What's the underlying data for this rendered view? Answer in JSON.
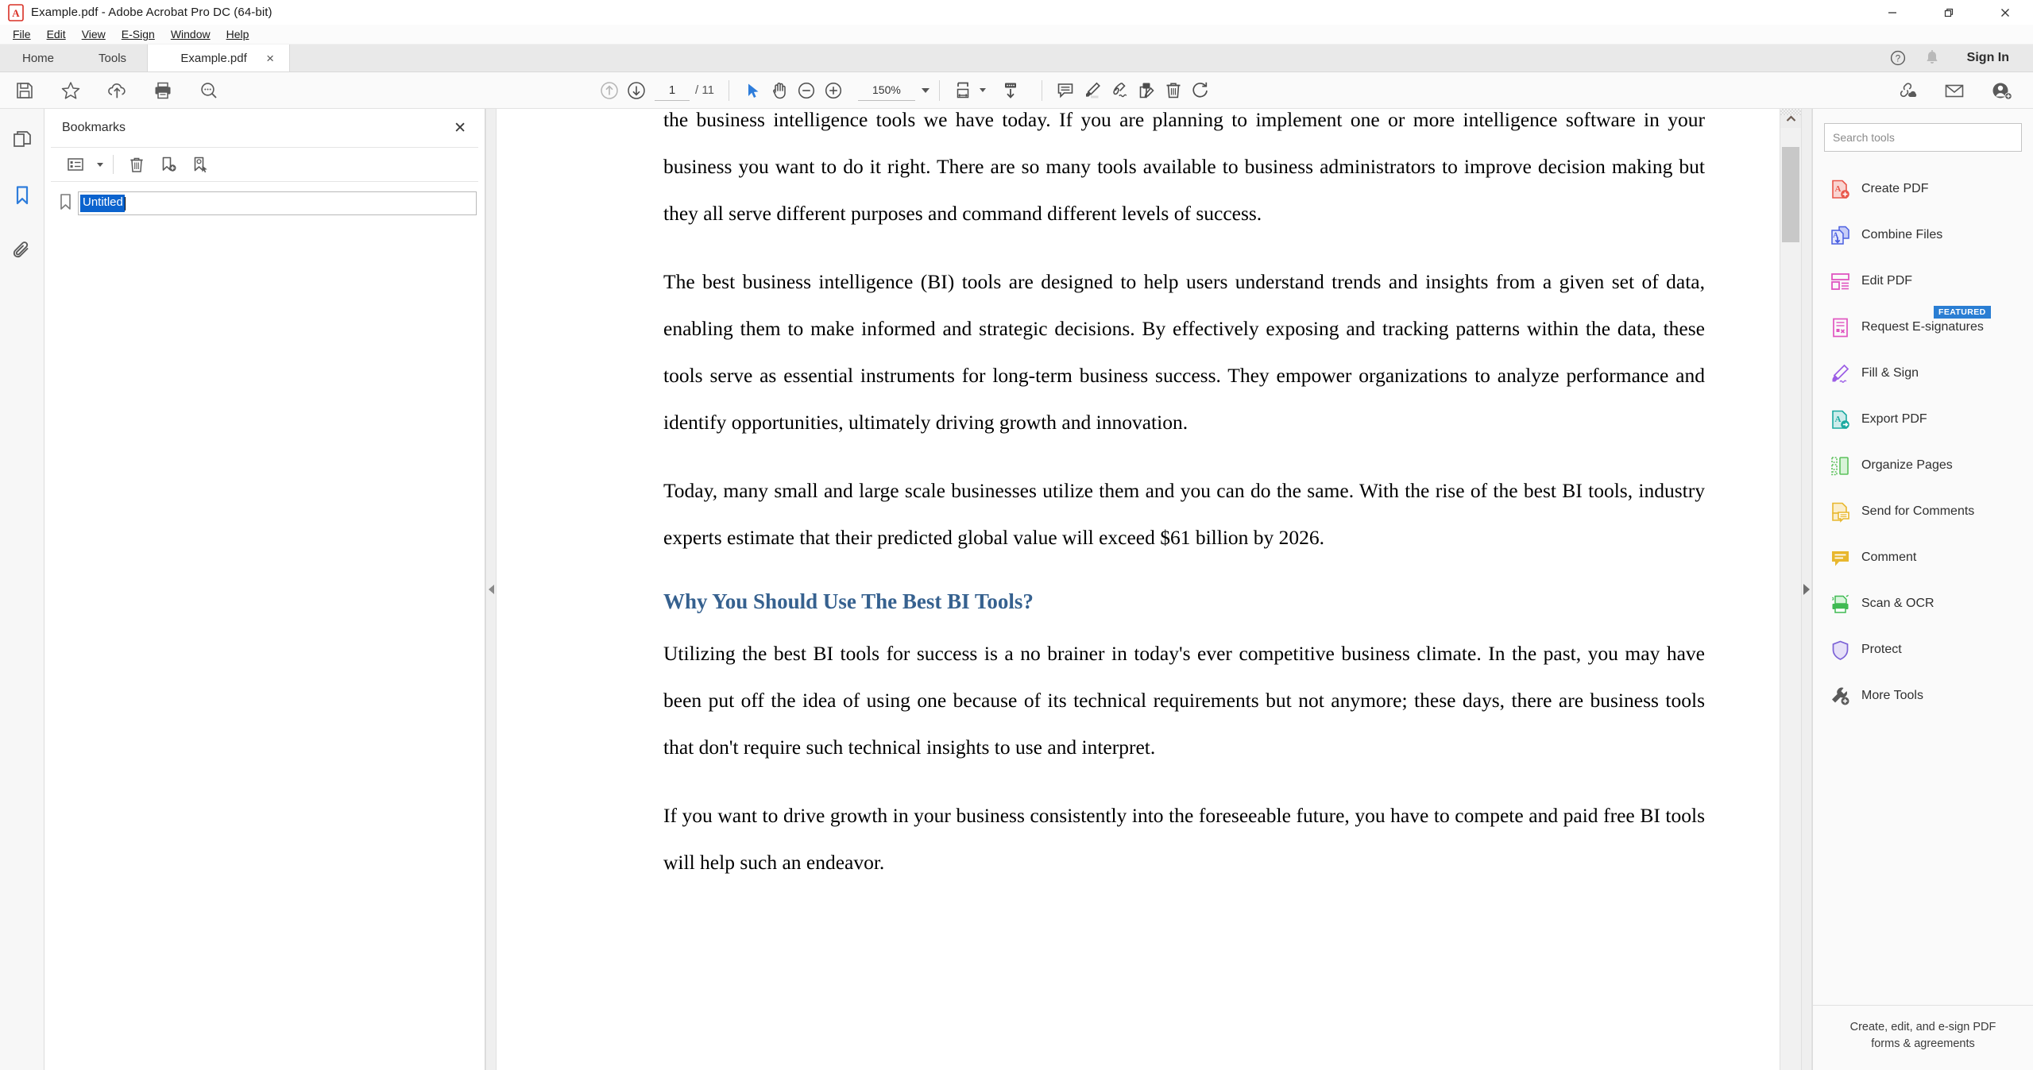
{
  "window": {
    "title": "Example.pdf - Adobe Acrobat Pro DC (64-bit)",
    "minimize": "—",
    "restore": "❐",
    "close": "✕"
  },
  "menubar": {
    "items": [
      {
        "label": "File",
        "key": "F"
      },
      {
        "label": "Edit",
        "key": "E"
      },
      {
        "label": "View",
        "key": "V"
      },
      {
        "label": "E-Sign",
        "key": "S"
      },
      {
        "label": "Window",
        "key": "W"
      },
      {
        "label": "Help",
        "key": "H"
      }
    ]
  },
  "tabbar": {
    "home": "Home",
    "tools": "Tools",
    "document_tab": "Example.pdf",
    "close_tab": "×",
    "help_icon": "help-circle-icon",
    "bell_icon": "bell-icon",
    "signin": "Sign In"
  },
  "toolbar": {
    "left_icons": [
      "save-icon",
      "star-icon",
      "upload-cloud-icon",
      "print-icon",
      "search-zoom-icon"
    ],
    "prev_page_icon": "arrow-up-circle-icon",
    "next_page_icon": "arrow-down-circle-icon",
    "page_current": "1",
    "page_total": "/ 11",
    "select_icon": "cursor-arrow-icon",
    "hand_icon": "hand-icon",
    "zoom_out_icon": "zoom-out-icon",
    "zoom_in_icon": "zoom-in-icon",
    "zoom_level": "150%",
    "fit_page_icon": "fit-page-icon",
    "scroll_mode_icon": "scroll-down-icon",
    "comment_icon": "comment-icon",
    "highlight_icon": "highlighter-icon",
    "sign_icon": "sign-pen-icon",
    "edit_page_icon": "edit-page-icon",
    "delete_icon": "trash-icon",
    "rotate_icon": "rotate-icon",
    "share_link_icon": "share-link-cloud-icon",
    "email_icon": "email-icon",
    "add_person_icon": "add-person-icon"
  },
  "rail": {
    "items": [
      {
        "name": "page-thumbnails-icon",
        "active": false
      },
      {
        "name": "bookmarks-icon",
        "active": true
      },
      {
        "name": "attachments-icon",
        "active": false
      }
    ]
  },
  "bookmarks": {
    "title": "Bookmarks",
    "close": "✕",
    "toolbar_icons": [
      "options-list-icon",
      "delete-bookmark-icon",
      "new-bookmark-icon",
      "find-bookmark-icon"
    ],
    "entry_value": "Untitled",
    "entry_selected": true
  },
  "document": {
    "paragraphs": [
      {
        "type": "p",
        "text": "the business intelligence tools we have today. If you are planning to implement one or more intelligence software in your business you want to do it right. There are so many tools available to business administrators to improve decision making but they all serve different purposes and command different levels of success."
      },
      {
        "type": "p",
        "text": "The best business intelligence (BI) tools are designed to help users understand trends and insights from a given set of data, enabling them to make informed and strategic decisions. By effectively exposing and tracking patterns within the data, these tools serve as essential instruments for long-term business success. They empower organizations to analyze performance and identify opportunities, ultimately driving growth and innovation."
      },
      {
        "type": "p",
        "text": "Today, many small and large scale businesses utilize them and you can do the same. With the rise of the best BI tools, industry experts estimate that their predicted global value will exceed $61 billion by 2026."
      },
      {
        "type": "h2",
        "text": "Why You Should Use The Best BI Tools?"
      },
      {
        "type": "p",
        "text": "Utilizing the best BI tools for success is a no brainer in today's ever competitive business climate. In the past, you may have been put off the idea of using one because of its technical requirements but not anymore; these days, there are business tools that don't require such technical insights to use and interpret."
      },
      {
        "type": "p",
        "text": "If you want to drive growth in your business consistently into the foreseeable future, you have to compete and paid free BI tools will help such an endeavor."
      }
    ],
    "heading_color": "#36618f"
  },
  "tools_panel": {
    "search_placeholder": "Search tools",
    "search_value": "",
    "items": [
      {
        "label": "Create PDF",
        "icon": "create-pdf-icon",
        "color": "#e8564a",
        "badge": null
      },
      {
        "label": "Combine Files",
        "icon": "combine-files-icon",
        "color": "#4a5fe0",
        "badge": null
      },
      {
        "label": "Edit PDF",
        "icon": "edit-pdf-icon",
        "color": "#e055c0",
        "badge": null
      },
      {
        "label": "Request E-signatures",
        "icon": "request-esignatures-icon",
        "color": "#e055c0",
        "badge": "FEATURED"
      },
      {
        "label": "Fill & Sign",
        "icon": "fill-sign-icon",
        "color": "#9b5de5",
        "badge": null
      },
      {
        "label": "Export PDF",
        "icon": "export-pdf-icon",
        "color": "#1ba9a0",
        "badge": null
      },
      {
        "label": "Organize Pages",
        "icon": "organize-pages-icon",
        "color": "#5cc15c",
        "badge": null
      },
      {
        "label": "Send for Comments",
        "icon": "send-for-comments-icon",
        "color": "#e8b72e",
        "badge": null
      },
      {
        "label": "Comment",
        "icon": "comment-tool-icon",
        "color": "#e8b72e",
        "badge": null
      },
      {
        "label": "Scan & OCR",
        "icon": "scan-ocr-icon",
        "color": "#3fba52",
        "badge": null
      },
      {
        "label": "Protect",
        "icon": "protect-shield-icon",
        "color": "#7b61d6",
        "badge": null
      },
      {
        "label": "More Tools",
        "icon": "more-tools-icon",
        "color": "#5a5a5a",
        "badge": null
      }
    ],
    "footer_line1": "Create, edit, and e-sign PDF",
    "footer_line2": "forms & agreements"
  },
  "colors": {
    "accent_blue": "#2a7ed3",
    "selection_blue": "#0b63ce",
    "heading_blue": "#36618f",
    "toolbar_bg": "#fafafa",
    "tabbar_bg": "#e9e9e9"
  }
}
